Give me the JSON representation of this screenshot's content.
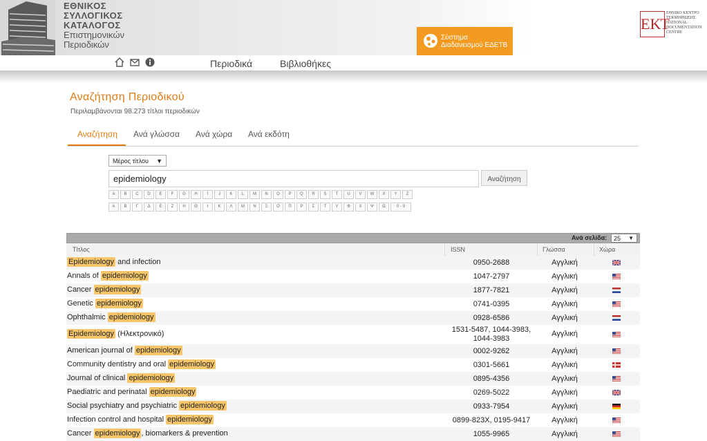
{
  "header": {
    "logo_lines": [
      "ΕΘΝΙΚΟΣ",
      "ΣΥΛΛΟΓΙΚΟΣ",
      "ΚΑΤΑΛΟΓΟΣ",
      "Επιστημονικών",
      "Περιοδικών"
    ],
    "edetb_line1": "Σύστημα",
    "edetb_line2": "Διαδανεισμού ΕΔΕΤΒ",
    "ekt_mark": "ΕΚΤ",
    "ekt_text": "ΕΘΝΙΚΟ ΚΕΝΤΡΟ ΤΕΚΜΗΡΙΩΣΗΣ NATIONAL DOCUMENTATION CENTRE"
  },
  "nav": {
    "icons": [
      "home-icon",
      "mail-icon",
      "info-icon"
    ],
    "links": [
      "Περιοδικά",
      "Βιβλιοθήκες"
    ]
  },
  "page": {
    "title": "Αναζήτηση Περιοδικού",
    "subtitle": "Περιλαμβάνονται 98.273 τίτλοι περιοδικών",
    "tabs": [
      "Αναζήτηση",
      "Ανά γλώσσα",
      "Ανά χώρα",
      "Ανά εκδότη"
    ],
    "active_tab": "Αναζήτηση"
  },
  "search": {
    "select_value": "Μέρος τίτλου",
    "query": "epidemiology",
    "button": "Αναζήτηση",
    "latin_letters": [
      "A",
      "B",
      "C",
      "D",
      "E",
      "F",
      "G",
      "H",
      "I",
      "J",
      "K",
      "L",
      "M",
      "N",
      "O",
      "P",
      "Q",
      "R",
      "S",
      "T",
      "U",
      "V",
      "W",
      "X",
      "Y",
      "Z"
    ],
    "greek_letters": [
      "Α",
      "Β",
      "Γ",
      "Δ",
      "Ε",
      "Ζ",
      "Η",
      "Θ",
      "Ι",
      "Κ",
      "Λ",
      "Μ",
      "Ν",
      "Ξ",
      "Ο",
      "Π",
      "Ρ",
      "Σ",
      "Τ",
      "Υ",
      "Φ",
      "Χ",
      "Ψ",
      "Ω",
      "0 - 9"
    ]
  },
  "table": {
    "per_page_label": "Ανά σελίδα:",
    "per_page_value": "25",
    "columns": [
      "Τίτλος",
      "ISSN",
      "Γλώσσα",
      "Χώρα"
    ],
    "rows": [
      {
        "pre": "",
        "hl": "Epidemiology",
        "post": " and infection",
        "issn": "0950-2688",
        "lang": "Αγγλική",
        "country": "gb"
      },
      {
        "pre": "Annals of ",
        "hl": "epidemiology",
        "post": "",
        "issn": "1047-2797",
        "lang": "Αγγλική",
        "country": "us"
      },
      {
        "pre": "Cancer ",
        "hl": "epidemiology",
        "post": "",
        "issn": "1877-7821",
        "lang": "Αγγλική",
        "country": "nl"
      },
      {
        "pre": "Genetic ",
        "hl": "epidemiology",
        "post": "",
        "issn": "0741-0395",
        "lang": "Αγγλική",
        "country": "us"
      },
      {
        "pre": "Ophthalmic ",
        "hl": "epidemiology",
        "post": "",
        "issn": "0928-6586",
        "lang": "Αγγλική",
        "country": "nl"
      },
      {
        "pre": "",
        "hl": "Epidemiology",
        "post": " (Ηλεκτρονικό)",
        "issn": "1531-5487, 1044-3983, 1044-3983",
        "lang": "Αγγλική",
        "country": "us",
        "tall": true
      },
      {
        "pre": "American journal of ",
        "hl": "epidemiology",
        "post": "",
        "issn": "0002-9262",
        "lang": "Αγγλική",
        "country": "us"
      },
      {
        "pre": "Community dentistry and oral ",
        "hl": "epidemiology",
        "post": "",
        "issn": "0301-5661",
        "lang": "Αγγλική",
        "country": "dk"
      },
      {
        "pre": "Journal of clinical ",
        "hl": "epidemiology",
        "post": "",
        "issn": "0895-4356",
        "lang": "Αγγλική",
        "country": "us"
      },
      {
        "pre": "Paediatric and perinatal ",
        "hl": "epidemiology",
        "post": "",
        "issn": "0269-5022",
        "lang": "Αγγλική",
        "country": "gb"
      },
      {
        "pre": "Social psychiatry and psychiatric ",
        "hl": "epidemiology",
        "post": "",
        "issn": "0933-7954",
        "lang": "Αγγλική",
        "country": "de"
      },
      {
        "pre": "Infection control and hospital ",
        "hl": "epidemiology",
        "post": "",
        "issn": "0899-823X, 0195-9417",
        "lang": "Αγγλική",
        "country": "us"
      },
      {
        "pre": "Cancer ",
        "hl": "epidemiology",
        "post": ", biomarkers & prevention",
        "issn": "1055-9965",
        "lang": "Αγγλική",
        "country": "us"
      }
    ]
  },
  "colors": {
    "accent": "#e07c12",
    "highlight": "#f7c66a",
    "edetb": "#f39a21"
  }
}
